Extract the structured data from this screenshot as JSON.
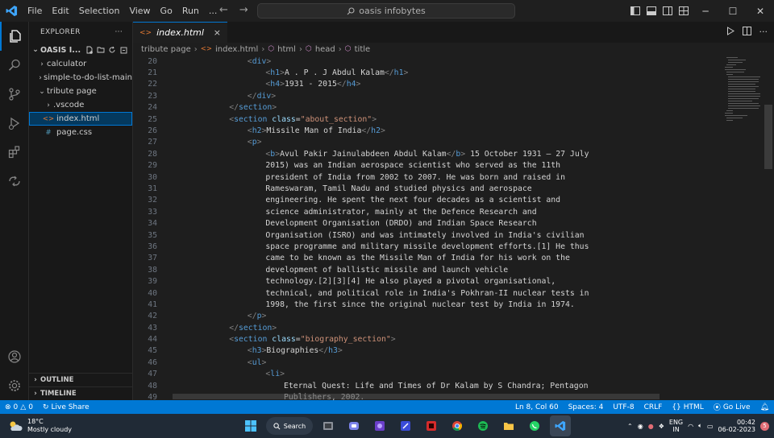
{
  "menu": [
    "File",
    "Edit",
    "Selection",
    "View",
    "Go",
    "Run",
    "..."
  ],
  "search": {
    "text": "oasis infobytes"
  },
  "explorer": {
    "header": "EXPLORER",
    "folder": "OASIS I...",
    "items": [
      {
        "label": "calculator",
        "type": "folder",
        "indent": 1,
        "open": false
      },
      {
        "label": "simple-to-do-list-main",
        "type": "folder",
        "indent": 1,
        "open": false
      },
      {
        "label": "tribute page",
        "type": "folder",
        "indent": 1,
        "open": true
      },
      {
        "label": ".vscode",
        "type": "folder",
        "indent": 2,
        "open": false
      },
      {
        "label": "index.html",
        "type": "html",
        "indent": 2,
        "selected": true
      },
      {
        "label": "page.css",
        "type": "css",
        "indent": 2
      }
    ],
    "outline": "OUTLINE",
    "timeline": "TIMELINE"
  },
  "tab": {
    "label": "index.html",
    "close": "×"
  },
  "breadcrumb": [
    "tribute page",
    "index.html",
    "html",
    "head",
    "title"
  ],
  "code": [
    {
      "n": "20",
      "indent": 3,
      "tokens": [
        [
          "br",
          "<"
        ],
        [
          "tag",
          "div"
        ],
        [
          "br",
          ">"
        ]
      ]
    },
    {
      "n": "21",
      "indent": 4,
      "tokens": [
        [
          "br",
          "<"
        ],
        [
          "tag",
          "h1"
        ],
        [
          "br",
          ">"
        ],
        [
          "plain",
          "A . P . J Abdul Kalam"
        ],
        [
          "br",
          "</"
        ],
        [
          "tag",
          "h1"
        ],
        [
          "br",
          ">"
        ]
      ]
    },
    {
      "n": "22",
      "indent": 4,
      "tokens": [
        [
          "br",
          "<"
        ],
        [
          "tag",
          "h4"
        ],
        [
          "br",
          ">"
        ],
        [
          "plain",
          "1931 - 2015"
        ],
        [
          "br",
          "</"
        ],
        [
          "tag",
          "h4"
        ],
        [
          "br",
          ">"
        ]
      ]
    },
    {
      "n": "23",
      "indent": 3,
      "tokens": [
        [
          "br",
          "</"
        ],
        [
          "tag",
          "div"
        ],
        [
          "br",
          ">"
        ]
      ]
    },
    {
      "n": "24",
      "indent": 2,
      "tokens": [
        [
          "br",
          "</"
        ],
        [
          "tag",
          "section"
        ],
        [
          "br",
          ">"
        ]
      ]
    },
    {
      "n": "25",
      "indent": 2,
      "tokens": [
        [
          "br",
          "<"
        ],
        [
          "tag",
          "section"
        ],
        [
          "plain",
          " "
        ],
        [
          "attr",
          "class"
        ],
        [
          "plain",
          "="
        ],
        [
          "str",
          "\"about_section\""
        ],
        [
          "br",
          ">"
        ]
      ]
    },
    {
      "n": "26",
      "indent": 3,
      "tokens": [
        [
          "br",
          "<"
        ],
        [
          "tag",
          "h2"
        ],
        [
          "br",
          ">"
        ],
        [
          "plain",
          "Missile Man of India"
        ],
        [
          "br",
          "</"
        ],
        [
          "tag",
          "h2"
        ],
        [
          "br",
          ">"
        ]
      ]
    },
    {
      "n": "27",
      "indent": 3,
      "tokens": [
        [
          "br",
          "<"
        ],
        [
          "tag",
          "p"
        ],
        [
          "br",
          ">"
        ]
      ]
    },
    {
      "n": "28",
      "indent": 4,
      "tokens": [
        [
          "br",
          "<"
        ],
        [
          "tag",
          "b"
        ],
        [
          "br",
          ">"
        ],
        [
          "plain",
          "Avul Pakir Jainulabdeen Abdul Kalam"
        ],
        [
          "br",
          "</"
        ],
        [
          "tag",
          "b"
        ],
        [
          "br",
          ">"
        ],
        [
          "plain",
          " 15 October 1931 – 27 July"
        ]
      ]
    },
    {
      "n": "29",
      "indent": 4,
      "tokens": [
        [
          "plain",
          "2015) was an Indian aerospace scientist who served as the 11th"
        ]
      ]
    },
    {
      "n": "30",
      "indent": 4,
      "tokens": [
        [
          "plain",
          "president of India from 2002 to 2007. He was born and raised in"
        ]
      ]
    },
    {
      "n": "31",
      "indent": 4,
      "tokens": [
        [
          "plain",
          "Rameswaram, Tamil Nadu and studied physics and aerospace"
        ]
      ]
    },
    {
      "n": "32",
      "indent": 4,
      "tokens": [
        [
          "plain",
          "engineering. He spent the next four decades as a scientist and"
        ]
      ]
    },
    {
      "n": "33",
      "indent": 4,
      "tokens": [
        [
          "plain",
          "science administrator, mainly at the Defence Research and"
        ]
      ]
    },
    {
      "n": "34",
      "indent": 4,
      "tokens": [
        [
          "plain",
          "Development Organisation (DRDO) and Indian Space Research"
        ]
      ]
    },
    {
      "n": "35",
      "indent": 4,
      "tokens": [
        [
          "plain",
          "Organisation (ISRO) and was intimately involved in India's civilian"
        ]
      ]
    },
    {
      "n": "36",
      "indent": 4,
      "tokens": [
        [
          "plain",
          "space programme and military missile development efforts.[1] He thus"
        ]
      ]
    },
    {
      "n": "37",
      "indent": 4,
      "tokens": [
        [
          "plain",
          "came to be known as the Missile Man of India for his work on the"
        ]
      ]
    },
    {
      "n": "38",
      "indent": 4,
      "tokens": [
        [
          "plain",
          "development of ballistic missile and launch vehicle"
        ]
      ]
    },
    {
      "n": "39",
      "indent": 4,
      "tokens": [
        [
          "plain",
          "technology.[2][3][4] He also played a pivotal organisational,"
        ]
      ]
    },
    {
      "n": "40",
      "indent": 4,
      "tokens": [
        [
          "plain",
          "technical, and political role in India's Pokhran-II nuclear tests in"
        ]
      ]
    },
    {
      "n": "41",
      "indent": 4,
      "tokens": [
        [
          "plain",
          "1998, the first since the original nuclear test by India in 1974."
        ]
      ]
    },
    {
      "n": "42",
      "indent": 3,
      "tokens": [
        [
          "br",
          "</"
        ],
        [
          "tag",
          "p"
        ],
        [
          "br",
          ">"
        ]
      ]
    },
    {
      "n": "43",
      "indent": 2,
      "tokens": [
        [
          "br",
          "</"
        ],
        [
          "tag",
          "section"
        ],
        [
          "br",
          ">"
        ]
      ]
    },
    {
      "n": "44",
      "indent": 2,
      "tokens": [
        [
          "br",
          "<"
        ],
        [
          "tag",
          "section"
        ],
        [
          "plain",
          " "
        ],
        [
          "attr",
          "class"
        ],
        [
          "plain",
          "="
        ],
        [
          "str",
          "\"biography_section\""
        ],
        [
          "br",
          ">"
        ]
      ]
    },
    {
      "n": "45",
      "indent": 3,
      "tokens": [
        [
          "br",
          "<"
        ],
        [
          "tag",
          "h3"
        ],
        [
          "br",
          ">"
        ],
        [
          "plain",
          "Biographies"
        ],
        [
          "br",
          "</"
        ],
        [
          "tag",
          "h3"
        ],
        [
          "br",
          ">"
        ]
      ]
    },
    {
      "n": "46",
      "indent": 3,
      "tokens": [
        [
          "br",
          "<"
        ],
        [
          "tag",
          "ul"
        ],
        [
          "br",
          ">"
        ]
      ]
    },
    {
      "n": "47",
      "indent": 4,
      "tokens": [
        [
          "br",
          "<"
        ],
        [
          "tag",
          "li"
        ],
        [
          "br",
          ">"
        ]
      ]
    },
    {
      "n": "48",
      "indent": 5,
      "tokens": [
        [
          "plain",
          "Eternal Quest: Life and Times of Dr Kalam by S Chandra; Pentagon"
        ]
      ]
    },
    {
      "n": "49",
      "indent": 5,
      "tokens": [
        [
          "plain",
          "Publishers, 2002."
        ]
      ]
    }
  ],
  "status": {
    "errors": "0",
    "warnings": "0",
    "live_share": "Live Share",
    "position": "Ln 8, Col 60",
    "spaces": "Spaces: 4",
    "encoding": "UTF-8",
    "eol": "CRLF",
    "language": "HTML",
    "go_live": "Go Live"
  },
  "taskbar": {
    "temp": "18°C",
    "weather": "Mostly cloudy",
    "search": "Search",
    "lang1": "ENG",
    "lang2": "IN",
    "time": "00:42",
    "date": "06-02-2023",
    "badge": "5"
  },
  "colors": {
    "accent": "#0078d4",
    "tag": "#569cd6",
    "string": "#ce9178",
    "attr": "#9cdcfe"
  }
}
